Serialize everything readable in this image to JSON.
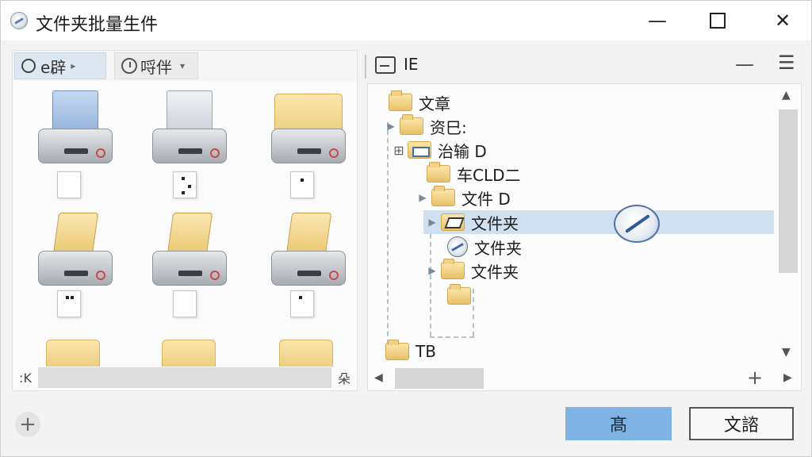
{
  "window": {
    "title": "文件夹批量生件",
    "controls": {
      "minimize": "—",
      "maximize": "",
      "close": "✕"
    }
  },
  "left_pane": {
    "toolbar": {
      "view_button": {
        "label": "e辟",
        "arrow": "▸"
      },
      "sort_button": {
        "label": "哷伴",
        "arrow": "▾"
      }
    },
    "scrollbar": {
      "left_label": ":K",
      "right_label": "朵"
    }
  },
  "right_pane": {
    "header": {
      "title": "IE",
      "minimize": "—",
      "menu": "☰"
    },
    "tree": [
      {
        "label": "文章",
        "icon": "folder-icon"
      },
      {
        "label": "资巳:",
        "icon": "folder-icon",
        "arrow": "▶"
      },
      {
        "label": "治输 D",
        "icon": "folder-blue-icon",
        "expander": "⊞"
      },
      {
        "label": "车CLD二",
        "icon": "folder-icon"
      },
      {
        "label": "文件 D",
        "icon": "folder-icon",
        "arrow": "▶"
      },
      {
        "label": "文件夹",
        "icon": "printer-folder-icon",
        "arrow": "▶",
        "selected": true
      },
      {
        "label": "文件夹",
        "icon": "disk-icon"
      },
      {
        "label": "文件夹",
        "icon": "folder-icon",
        "arrow": "▶"
      },
      {
        "label": "",
        "icon": "folder-icon"
      },
      {
        "label": "TB",
        "icon": "folder-icon"
      }
    ],
    "scroll": {
      "up": "▲",
      "down": "▼",
      "left": "◀",
      "right": "▶",
      "plus": "+"
    }
  },
  "footer": {
    "add_label": "+",
    "primary_label": "髙",
    "secondary_label": "文諮"
  },
  "colors": {
    "selection": "#cfe0f1",
    "primary_button": "#7eb3e3",
    "folder": "#e8c168"
  }
}
